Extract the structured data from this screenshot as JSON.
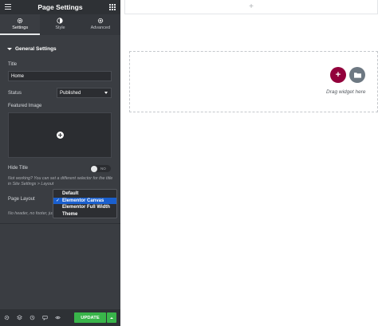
{
  "panel": {
    "title": "Page Settings",
    "tabs": [
      {
        "label": "Settings",
        "icon": "gear-icon",
        "active": true
      },
      {
        "label": "Style",
        "icon": "half-circle-icon",
        "active": false
      },
      {
        "label": "Advanced",
        "icon": "gear-icon",
        "active": false
      }
    ],
    "section_title": "General Settings",
    "title_label": "Title",
    "title_value": "Home",
    "status_label": "Status",
    "status_value": "Published",
    "featured_image_label": "Featured Image",
    "hide_title_label": "Hide Title",
    "hide_title_toggle_text": "NO",
    "hint_text": "Not working? You can set a different selector for the title in Site Settings > Layout",
    "page_layout_label": "Page Layout",
    "layout_hint": "No header, no footer, just",
    "layout_options": [
      {
        "label": "Default",
        "selected": false
      },
      {
        "label": "Elementor Canvas",
        "selected": true
      },
      {
        "label": "Elementor Full Width",
        "selected": false
      },
      {
        "label": "Theme",
        "selected": false
      }
    ],
    "check_mark": "✓"
  },
  "footer": {
    "icons": [
      "gear-icon",
      "layers-icon",
      "history-icon",
      "comment-icon",
      "eye-icon"
    ],
    "update_label": "UPDATE"
  },
  "canvas": {
    "top_add_symbol": "+",
    "add_symbol": "+",
    "drag_text": "Drag widget here"
  },
  "colors": {
    "panel_bg": "#3a3d42",
    "accent_green": "#39b54a",
    "add_button": "#92003b",
    "folder_button": "#6d7882",
    "dropdown_selected": "#1a5fce"
  }
}
